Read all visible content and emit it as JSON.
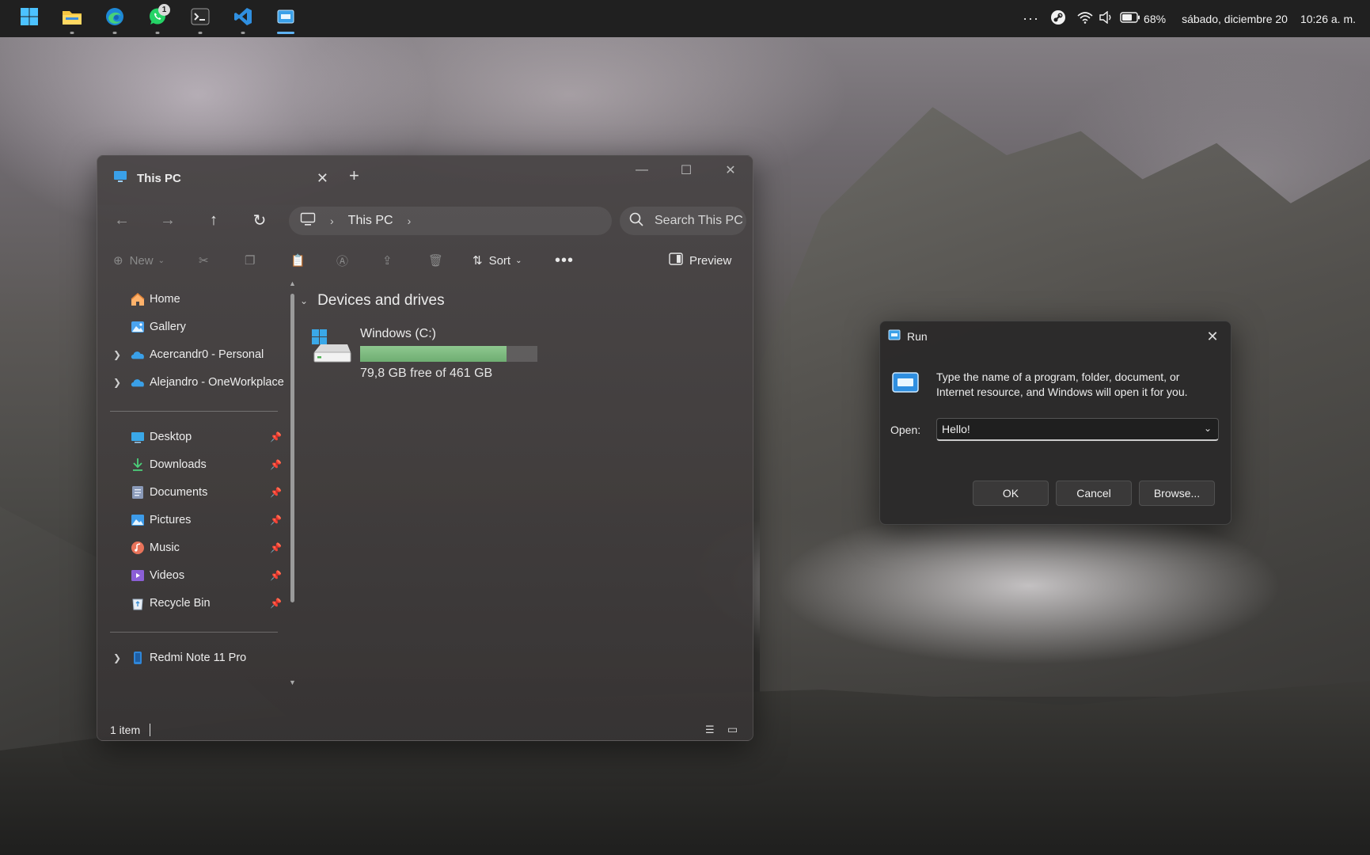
{
  "taskbar": {
    "apps": [
      {
        "name": "start",
        "icon": "windows-logo-icon",
        "running": false
      },
      {
        "name": "file-explorer",
        "icon": "folder-icon",
        "running": true
      },
      {
        "name": "edge",
        "icon": "edge-icon",
        "running": true
      },
      {
        "name": "whatsapp",
        "icon": "whatsapp-icon",
        "running": true,
        "badge": "1"
      },
      {
        "name": "terminal",
        "icon": "terminal-icon",
        "running": true
      },
      {
        "name": "vscode",
        "icon": "vscode-icon",
        "running": true
      },
      {
        "name": "run",
        "icon": "run-icon",
        "running": true,
        "active": true
      }
    ],
    "tray": {
      "battery": "68%",
      "date": "sábado, diciembre 20",
      "time": "10:26 a. m."
    }
  },
  "explorer": {
    "tab_title": "This PC",
    "address": {
      "location": "This PC"
    },
    "search_placeholder": "Search This PC",
    "toolbar": {
      "new_label": "New",
      "sort_label": "Sort",
      "preview_label": "Preview"
    },
    "sidebar": {
      "top_items": [
        {
          "label": "Home",
          "icon": "home-icon",
          "expandable": false
        },
        {
          "label": "Gallery",
          "icon": "gallery-icon",
          "expandable": false
        },
        {
          "label": "Acercandr0 - Personal",
          "icon": "onedrive-icon",
          "expandable": true
        },
        {
          "label": "Alejandro - OneWorkplace",
          "icon": "onedrive-icon",
          "expandable": true
        }
      ],
      "pinned_items": [
        {
          "label": "Desktop",
          "icon": "desktop-icon"
        },
        {
          "label": "Downloads",
          "icon": "downloads-icon"
        },
        {
          "label": "Documents",
          "icon": "documents-icon"
        },
        {
          "label": "Pictures",
          "icon": "pictures-icon"
        },
        {
          "label": "Music",
          "icon": "music-icon"
        },
        {
          "label": "Videos",
          "icon": "videos-icon"
        },
        {
          "label": "Recycle Bin",
          "icon": "recycle-bin-icon"
        }
      ],
      "device_items": [
        {
          "label": "Redmi Note 11 Pro",
          "icon": "phone-icon",
          "expandable": true
        }
      ]
    },
    "section_title": "Devices and drives",
    "drive": {
      "name": "Windows (C:)",
      "free_text": "79,8 GB free of 461 GB",
      "used_fraction": 0.827
    },
    "status": {
      "item_count": "1 item"
    }
  },
  "run_dialog": {
    "title": "Run",
    "description": "Type the name of a program, folder, document, or Internet resource, and Windows will open it for you.",
    "open_label": "Open:",
    "open_value": "Hello!",
    "buttons": {
      "ok": "OK",
      "cancel": "Cancel",
      "browse": "Browse..."
    }
  },
  "colors": {
    "accent": "#5fb2f2",
    "drive_fill": "#7dbb80",
    "taskbar_bg": "#202020"
  }
}
